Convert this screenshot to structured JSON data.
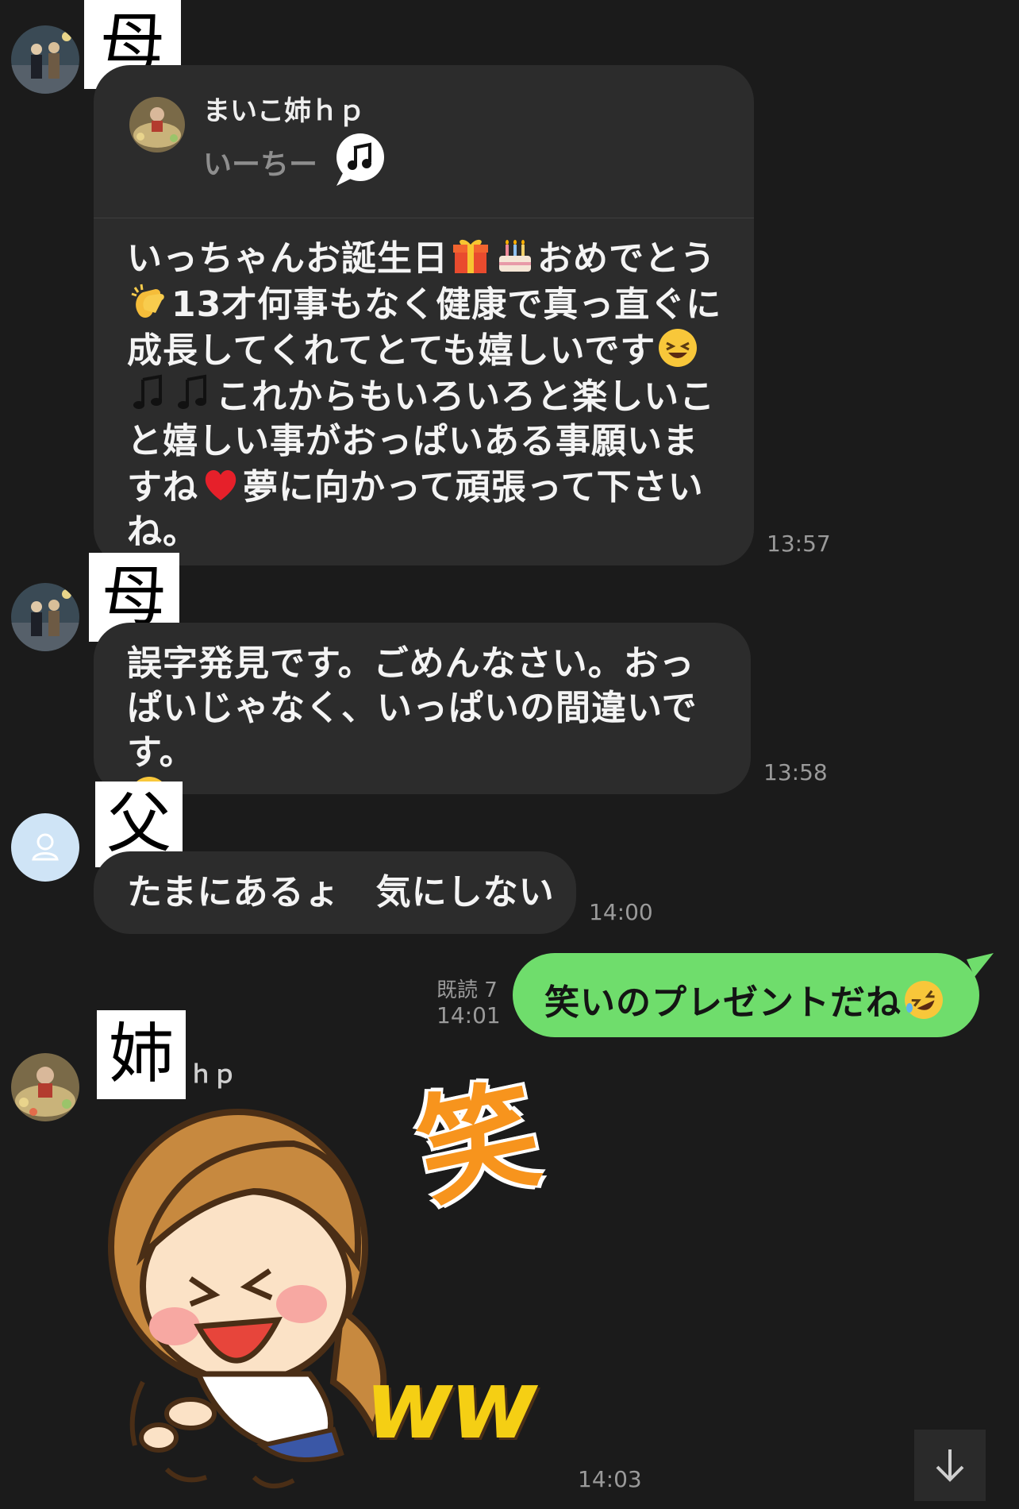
{
  "messages": [
    {
      "sender_label": "母",
      "quote": {
        "name": "まいこ姉ｈｐ",
        "subtitle": "いーちー"
      },
      "text_parts": [
        "いっちゃんお誕生日",
        "",
        "おめでとう",
        "13才何事もなく健康で真っ直ぐに成長してくれてとても嬉しいです",
        "",
        "これからもいろいろと楽しいこと嬉しい事がおっぱいある事願いますね",
        "夢に向かって頑張って下さいね。"
      ],
      "time": "13:57"
    },
    {
      "sender_label": "母",
      "text_parts": [
        "誤字発見です。ごめんなさい。おっぱいじゃなく、いっぱいの間違いです。"
      ],
      "time": "13:58"
    },
    {
      "sender_label": "父",
      "text": "たまにあるょ　気にしない",
      "time": "14:00"
    },
    {
      "self": true,
      "read_status": "既読 7",
      "text": "笑いのプレゼントだね",
      "time": "14:01"
    },
    {
      "sender_label": "姉",
      "sender_name_suffix": "ｈｐ",
      "sticker": {
        "big_char": "笑",
        "ww": "ww"
      },
      "time": "14:03"
    }
  ],
  "icons": [
    "gift-emoji",
    "cake-emoji",
    "clap-emoji",
    "laughing-emoji",
    "music-note-emoji",
    "heart-emoji",
    "star-struck-emoji",
    "rofl-emoji",
    "music-note-icon",
    "person-icon",
    "arrow-down-icon"
  ],
  "colors": {
    "background": "#1b1b1b",
    "bubble": "#2c2c2c",
    "self_bubble": "#6fdd6c",
    "time": "#9a9a9a"
  }
}
